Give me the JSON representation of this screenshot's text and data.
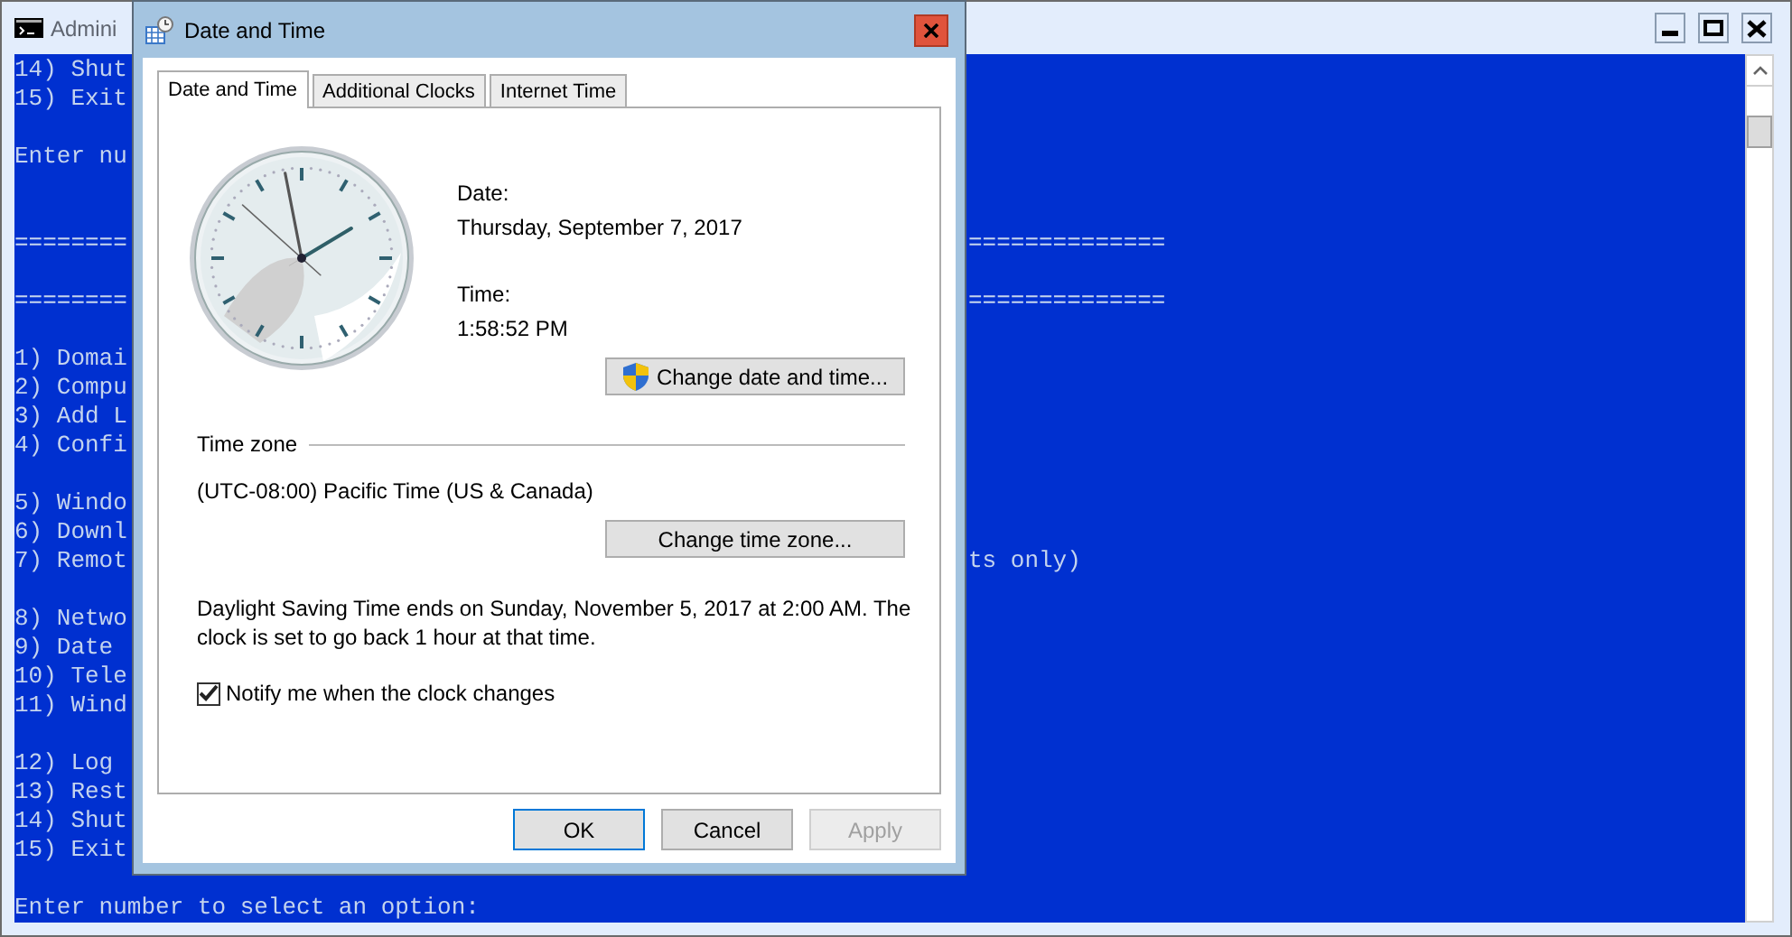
{
  "console": {
    "title": "Admini",
    "lines": [
      {
        "kind": "text",
        "left": "14) Shut"
      },
      {
        "kind": "text",
        "left": "15) Exit"
      },
      {
        "kind": "blank"
      },
      {
        "kind": "text",
        "left": "Enter nu"
      },
      {
        "kind": "blank"
      },
      {
        "kind": "blank"
      },
      {
        "kind": "text",
        "left": "========",
        "right": "=============="
      },
      {
        "kind": "blank"
      },
      {
        "kind": "text",
        "left": "========",
        "right": "=============="
      },
      {
        "kind": "blank"
      },
      {
        "kind": "text",
        "left": "1) Domai"
      },
      {
        "kind": "text",
        "left": "2) Compu"
      },
      {
        "kind": "text",
        "left": "3) Add L"
      },
      {
        "kind": "text",
        "left": "4) Confi"
      },
      {
        "kind": "blank"
      },
      {
        "kind": "text",
        "left": "5) Windo"
      },
      {
        "kind": "text",
        "left": "6) Downl"
      },
      {
        "kind": "text",
        "left": "7) Remot",
        "right": "ts only)"
      },
      {
        "kind": "blank"
      },
      {
        "kind": "text",
        "left": "8) Netwo"
      },
      {
        "kind": "text",
        "left": "9) Date"
      },
      {
        "kind": "text",
        "left": "10) Tele"
      },
      {
        "kind": "text",
        "left": "11) Wind"
      },
      {
        "kind": "blank"
      },
      {
        "kind": "text",
        "left": "12) Log"
      },
      {
        "kind": "text",
        "left": "13) Rest"
      },
      {
        "kind": "text",
        "left": "14) Shut"
      },
      {
        "kind": "text",
        "left": "15) Exit"
      },
      {
        "kind": "blank"
      },
      {
        "kind": "text",
        "left": "Enter number to select an option:"
      }
    ]
  },
  "dialog": {
    "title": "Date and Time",
    "tabs": [
      {
        "label": "Date and Time",
        "selected": true
      },
      {
        "label": "Additional Clocks",
        "selected": false
      },
      {
        "label": "Internet Time",
        "selected": false
      }
    ],
    "date_label": "Date:",
    "date": "Thursday, September 7, 2017",
    "time_label": "Time:",
    "time": "1:58:52 PM",
    "change_datetime_button": "Change date and time...",
    "time_zone": {
      "heading": "Time zone",
      "value": "(UTC-08:00) Pacific Time (US & Canada)",
      "button": "Change time zone..."
    },
    "dst_notice": "Daylight Saving Time ends on Sunday, November 5, 2017 at 2:00 AM. The clock is set to go back 1 hour at that time.",
    "notify": {
      "label": "Notify me when the clock changes",
      "checked": true
    },
    "buttons": [
      {
        "label": "OK",
        "default": true,
        "disabled": false
      },
      {
        "label": "Cancel",
        "default": false,
        "disabled": false
      },
      {
        "label": "Apply",
        "default": false,
        "disabled": true
      }
    ]
  }
}
